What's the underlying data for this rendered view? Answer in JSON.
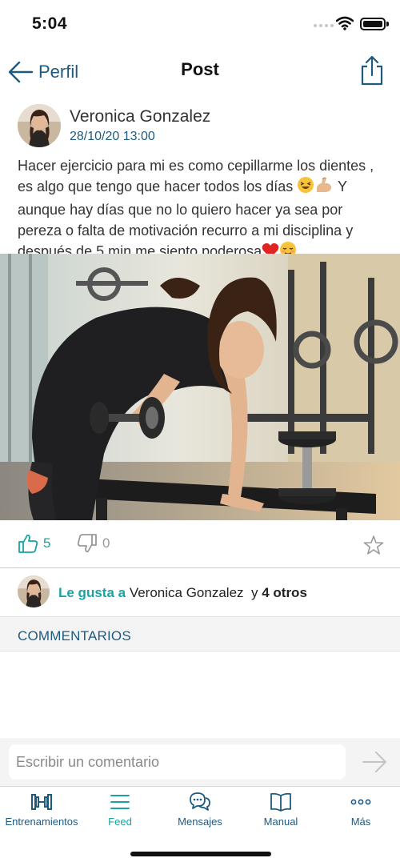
{
  "status": {
    "time": "5:04"
  },
  "nav": {
    "back_label": "Perfil",
    "title": "Post"
  },
  "post": {
    "author": "Veronica Gonzalez",
    "date": "28/10/20 13:00",
    "text_1": "Hacer ejercicio para mi es como cepillarme los dientes , es algo que tengo que hacer todos los días ",
    "text_2": " Y aunque hay días que no lo quiero hacer ya sea por pereza o falta de motivación recurro a mi disciplina y después de 5 min me siento poderosa",
    "likes": "5",
    "dislikes": "0"
  },
  "likes_row": {
    "prefix": "Le gusta a",
    "user": "Veronica Gonzalez",
    "and": "y",
    "others": "4 otros"
  },
  "comments": {
    "title": "COMMENTARIOS",
    "placeholder": "Escribir un comentario"
  },
  "tabs": [
    {
      "label": "Entrenamientos",
      "icon": "dumbbell-icon"
    },
    {
      "label": "Feed",
      "icon": "menu-icon"
    },
    {
      "label": "Mensajes",
      "icon": "chat-icon"
    },
    {
      "label": "Manual",
      "icon": "book-icon"
    },
    {
      "label": "Más",
      "icon": "more-icon"
    }
  ],
  "colors": {
    "primary": "#1e5a80",
    "accent": "#1aa3a3"
  }
}
